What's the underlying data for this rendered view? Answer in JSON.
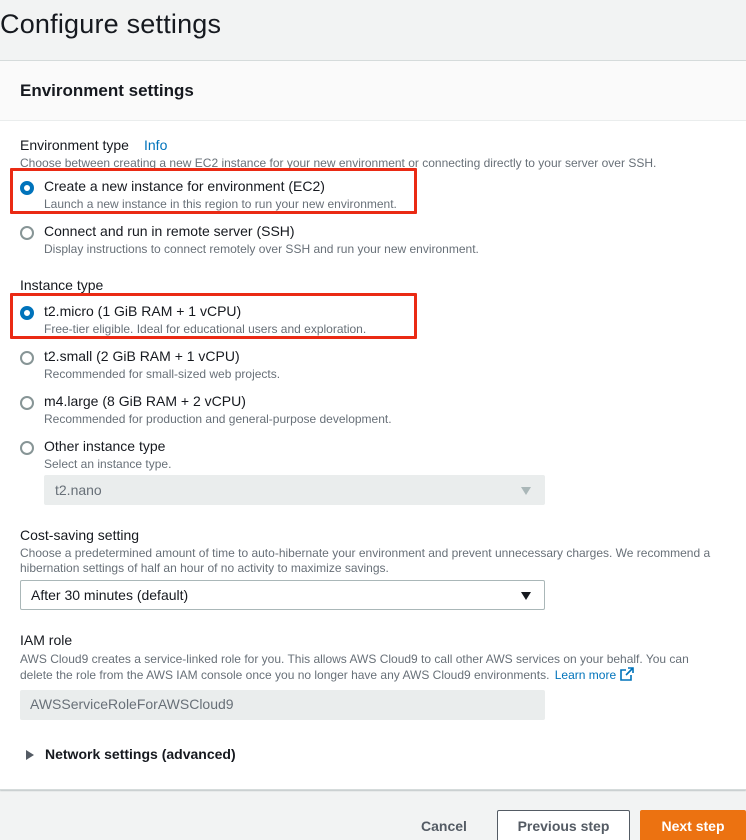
{
  "page": {
    "title": "Configure settings"
  },
  "panel": {
    "title": "Environment settings"
  },
  "environment_type": {
    "label": "Environment type",
    "info_link": "Info",
    "description": "Choose between creating a new EC2 instance for your new environment or connecting directly to your server over SSH.",
    "options": [
      {
        "label": "Create a new instance for environment (EC2)",
        "description": "Launch a new instance in this region to run your new environment.",
        "selected": true,
        "highlighted": true
      },
      {
        "label": "Connect and run in remote server (SSH)",
        "description": "Display instructions to connect remotely over SSH and run your new environment.",
        "selected": false,
        "highlighted": false
      }
    ]
  },
  "instance_type": {
    "label": "Instance type",
    "options": [
      {
        "label": "t2.micro (1 GiB RAM + 1 vCPU)",
        "description": "Free-tier eligible. Ideal for educational users and exploration.",
        "selected": true,
        "highlighted": true
      },
      {
        "label": "t2.small (2 GiB RAM + 1 vCPU)",
        "description": "Recommended for small-sized web projects.",
        "selected": false,
        "highlighted": false
      },
      {
        "label": "m4.large (8 GiB RAM + 2 vCPU)",
        "description": "Recommended for production and general-purpose development.",
        "selected": false,
        "highlighted": false
      },
      {
        "label": "Other instance type",
        "description": "Select an instance type.",
        "selected": false,
        "highlighted": false
      }
    ],
    "other_select_value": "t2.nano"
  },
  "cost_saving": {
    "label": "Cost-saving setting",
    "description_line1": "Choose a predetermined amount of time to auto-hibernate your environment and prevent unnecessary charges. We recommend a",
    "description_line2": "hibernation settings of half an hour of no activity to maximize savings.",
    "selected_value": "After 30 minutes (default)"
  },
  "iam_role": {
    "label": "IAM role",
    "description_line1": "AWS Cloud9 creates a service-linked role for you. This allows AWS Cloud9 to call other AWS services on your behalf. You can",
    "description_line2": "delete the role from the AWS IAM console once you no longer have any AWS Cloud9 environments.",
    "learn_more": "Learn more",
    "value": "AWSServiceRoleForAWSCloud9"
  },
  "network_settings": {
    "label": "Network settings (advanced)"
  },
  "footer": {
    "cancel": "Cancel",
    "previous": "Previous step",
    "next": "Next step"
  },
  "colors": {
    "accent": "#0073bb",
    "highlight": "#ea2a14",
    "primary_button": "#ec7211"
  }
}
